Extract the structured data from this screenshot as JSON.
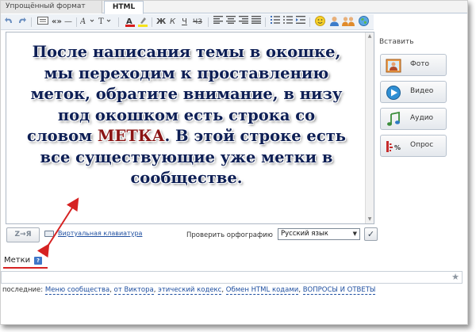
{
  "tabs": [
    {
      "label": "Упрощённый формат"
    },
    {
      "label": "HTML"
    }
  ],
  "toolbar": {
    "bold": "Ж",
    "italic": "К",
    "underline": "Ч",
    "strike": "ЧЗ"
  },
  "message": {
    "lines": [
      "После написания темы в окошке,",
      "мы переходим к проставлению",
      "меток, обратите внимание, в низу",
      "под окошком есть строка со",
      "словом ",
      "МЕТКА",
      ". В этой строке есть",
      "все существующие уже метки в",
      "сообществе."
    ]
  },
  "insert": {
    "title": "Вставить",
    "photo": "Фото",
    "video": "Видео",
    "audio": "Аудио",
    "poll": "Опрос",
    "poll_icon_text": "%"
  },
  "bottom": {
    "az": "Z→Я",
    "keyboard_link": "Виртуальная клавиатура",
    "spellcheck_label": "Проверить орфографию",
    "language": "Русский язык"
  },
  "tags": {
    "label": "Метки",
    "help": "?",
    "recent_label": "последние:",
    "recent": [
      "Меню сообщества",
      "от Виктора",
      "этический кодекс",
      "Обмен HTML кодами",
      "ВОПРОСЫ И ОТВЕТЫ"
    ]
  },
  "colors": {
    "arrow": "#d62222",
    "message_text": "#0e1f55",
    "keyword": "#8a1414",
    "link": "#1f4fa0"
  }
}
